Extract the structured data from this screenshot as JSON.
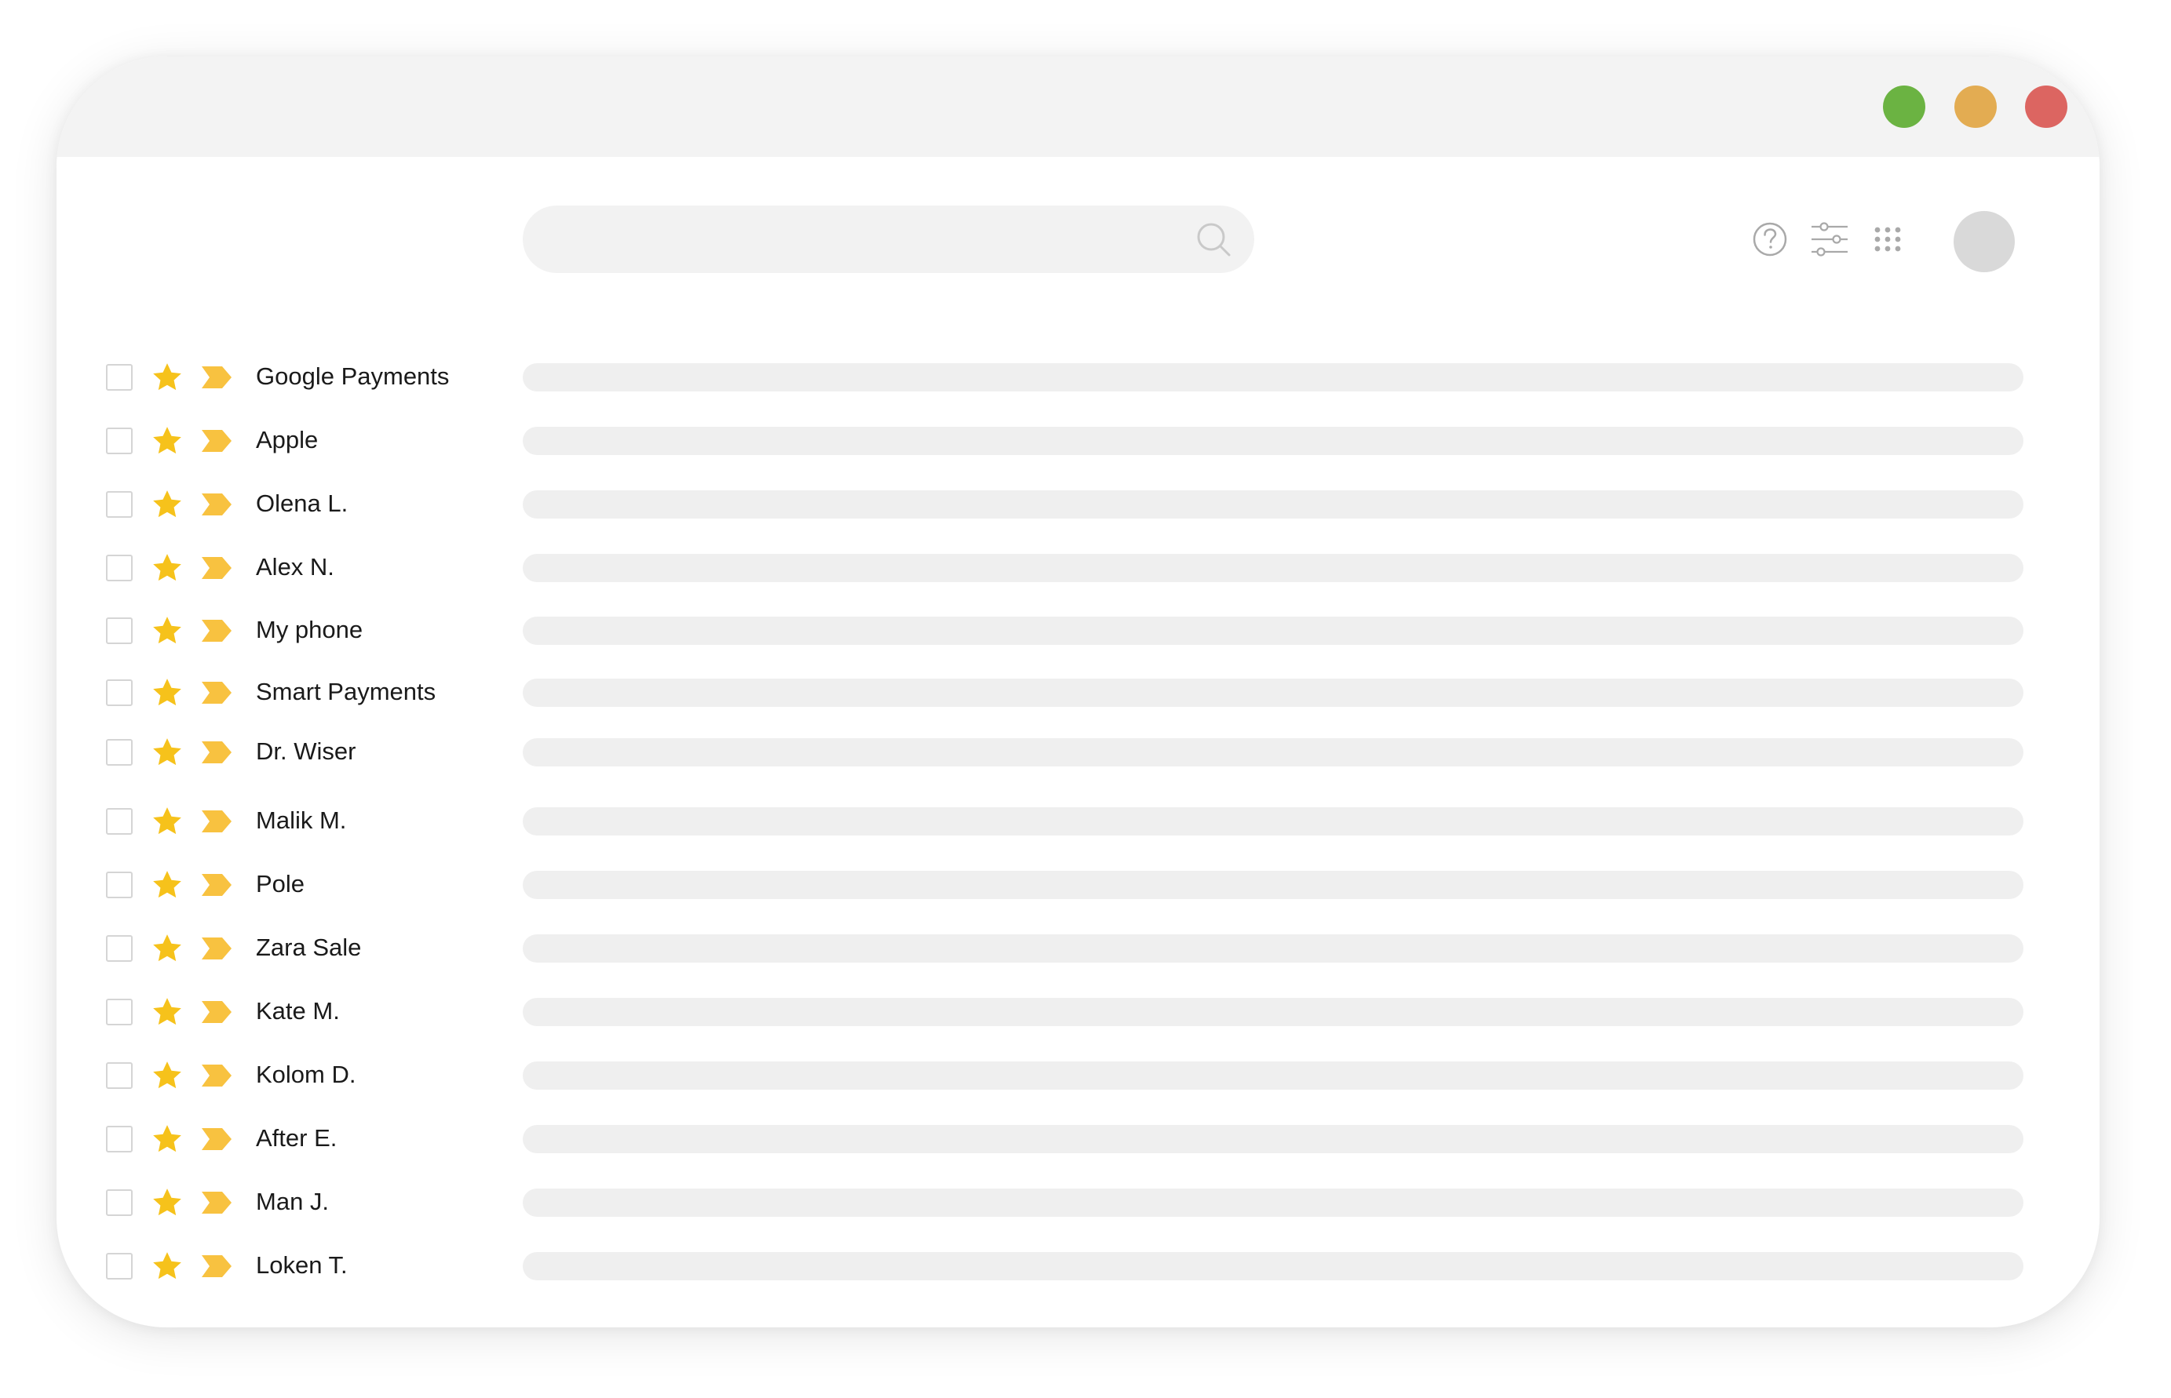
{
  "window": {
    "controls": [
      {
        "name": "green",
        "color": "#6bb342"
      },
      {
        "name": "yellow",
        "color": "#e3ac52"
      },
      {
        "name": "red",
        "color": "#dc6561"
      }
    ]
  },
  "toolbar": {
    "search": {
      "value": "",
      "placeholder": ""
    },
    "icons": [
      "search-icon",
      "help-icon",
      "sliders-icon",
      "apps-grid-icon",
      "avatar"
    ]
  },
  "colors": {
    "star": "#f6c21b",
    "tag": "#f8c240",
    "skeleton": "#efefef",
    "titlebar": "#f3f3f3"
  },
  "messages": [
    {
      "sender": "Google Payments"
    },
    {
      "sender": "Apple"
    },
    {
      "sender": "Olena L."
    },
    {
      "sender": "Alex N."
    },
    {
      "sender": "My phone"
    },
    {
      "sender": "Smart Payments"
    },
    {
      "sender": "Dr. Wiser"
    },
    {
      "sender": "Malik M."
    },
    {
      "sender": "Pole"
    },
    {
      "sender": "Zara Sale"
    },
    {
      "sender": "Kate M."
    },
    {
      "sender": "Kolom D."
    },
    {
      "sender": "After E."
    },
    {
      "sender": "Man J."
    },
    {
      "sender": "Loken T."
    }
  ]
}
